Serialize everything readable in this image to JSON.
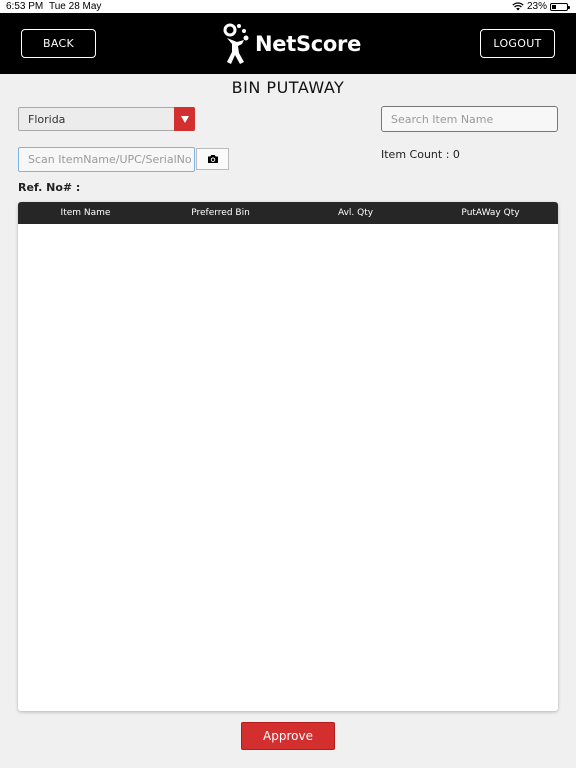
{
  "status_bar": {
    "time": "6:53 PM",
    "date": "Tue 28 May",
    "battery": "23%",
    "icons": [
      "wifi-icon",
      "battery-icon"
    ]
  },
  "header": {
    "back_label": "BACK",
    "logout_label": "LOGOUT",
    "logo_text": "NetScore",
    "background_color": "#000000"
  },
  "page_title": "BIN PUTAWAY",
  "location_select": {
    "selected": "Florida",
    "arrow_color": "#d32f2f"
  },
  "search": {
    "placeholder": "Search Item Name"
  },
  "scan": {
    "placeholder": "Scan ItemName/UPC/SerialNo",
    "button_icon": "camera-icon"
  },
  "item_count": "Item Count : 0",
  "ref_no_label": "Ref. No# :",
  "table": {
    "columns": [
      "Item Name",
      "Preferred Bin",
      "Avl. Qty",
      "PutAWay Qty"
    ],
    "rows": []
  },
  "approve_label": "Approve",
  "accent_color": "#d32f2f"
}
